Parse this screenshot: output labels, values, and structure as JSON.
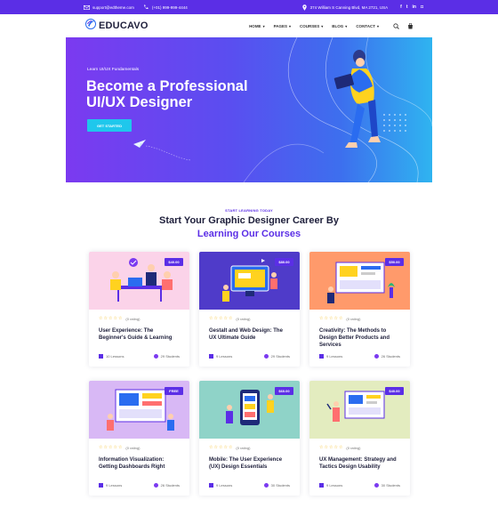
{
  "topbar": {
    "email": "support@edtheme.com",
    "phone": "(+01) 999-999-4444",
    "address": "374 William S Canning Blvd, MA 2721, USA",
    "social_icons": [
      "facebook-icon",
      "twitter-icon",
      "linkedin-icon",
      "instagram-icon"
    ],
    "social_glyphs": [
      "f",
      "t",
      "in",
      "◘"
    ]
  },
  "nav": {
    "logo": "EDUCAVO",
    "menu": [
      "HOME",
      "PAGES",
      "COURSES",
      "BLOG",
      "CONTACT"
    ]
  },
  "hero": {
    "subtitle": "Learn UI/UX Fundamentals",
    "title_line1": "Become a Professional",
    "title_line2": "UI/UX Designer",
    "cta": "GET STARTED"
  },
  "section": {
    "kicker": "START LEARNING TODAY",
    "heading": "Start Your Graphic Designer Career By",
    "heading_accent": "Learning Our Courses"
  },
  "courses": [
    {
      "price": "$40.00",
      "rating": "(0 rating)",
      "title": "User Experience: The Beginner's Guide & Learning",
      "lessons": "10 Lessons",
      "students": "29 Students"
    },
    {
      "price": "$80.00",
      "rating": "(0 rating)",
      "title": "Gestalt and Web Design: The UX Ultimate Guide",
      "lessons": "9 Lessons",
      "students": "29 Students"
    },
    {
      "price": "$50.00",
      "rating": "(0 rating)",
      "title": "Creativity: The Methods to Design Better Products and Services",
      "lessons": "9 Lessons",
      "students": "26 Students"
    },
    {
      "price": "FREE",
      "rating": "(0 rating)",
      "title": "Information Visualization: Getting Dashboards Right",
      "lessons": "9 Lessons",
      "students": "26 Students"
    },
    {
      "price": "$60.00",
      "rating": "(0 rating)",
      "title": "Mobile: The User Experience (UX) Design Essentials",
      "lessons": "9 Lessons",
      "students": "30 Students"
    },
    {
      "price": "$40.00",
      "rating": "(0 rating)",
      "title": "UX Management: Strategy and Tactics Design Usability",
      "lessons": "9 Lessons",
      "students": "30 Students"
    }
  ],
  "colors": {
    "accent": "#5b2ee6",
    "cta": "#1fc7ec",
    "star": "#f4b400"
  }
}
